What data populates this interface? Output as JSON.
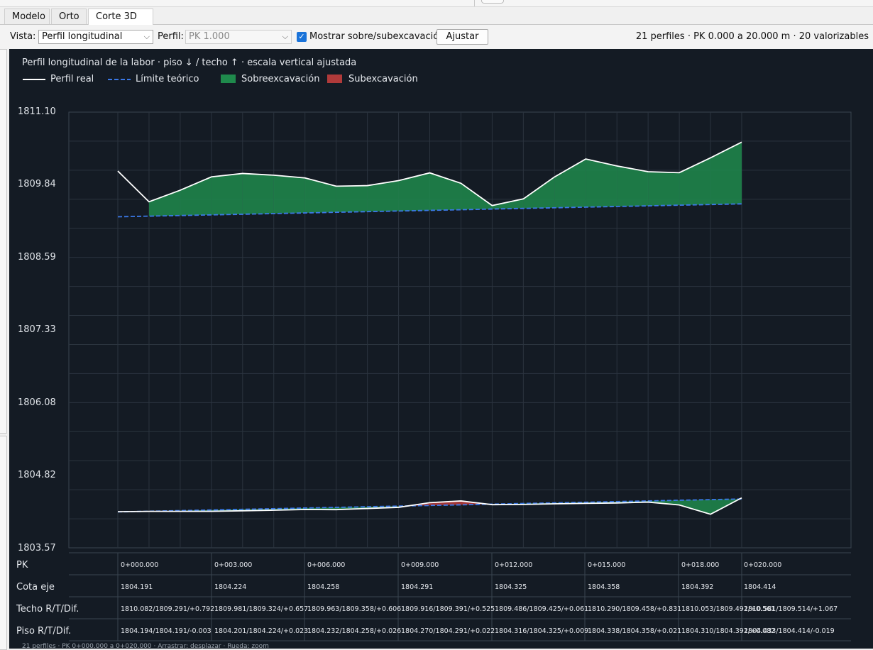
{
  "tabs": [
    {
      "label": "Modelo",
      "active": false
    },
    {
      "label": "Orto",
      "active": false
    },
    {
      "label": "Corte 3D",
      "active": true,
      "closable": true
    }
  ],
  "toolbar": {
    "vista_label": "Vista:",
    "vista_value": "Perfil longitudinal",
    "perfil_label": "Perfil:",
    "perfil_value": "PK 1.000",
    "perfil_enabled": false,
    "mostrar_label": "Mostrar sobre/subexcavación",
    "mostrar_checked": true,
    "ajustar_label": "Ajustar",
    "status": "21 perfiles · PK 0.000 a 20.000 m · 20 valorizables"
  },
  "panel": {
    "title": "Perfil longitudinal de la labor · piso ↓ / techo ↑ · escala vertical ajustada",
    "legend": [
      {
        "label": "Perfil real",
        "kind": "line",
        "color": "#ffffff"
      },
      {
        "label": "Límite teórico",
        "kind": "dashed",
        "color": "#3b78e7"
      },
      {
        "label": "Sobreexcavación",
        "kind": "fill",
        "color": "#1f8a4c"
      },
      {
        "label": "Subexcavación",
        "kind": "fill",
        "color": "#b03a3a"
      }
    ],
    "footer": "21 perfiles · PK 0+000.000 a 0+020.000 · Arrastrar: desplazar · Rueda: zoom"
  },
  "chart_data": {
    "type": "line",
    "xlabel": "PK",
    "x": [
      0,
      1,
      2,
      3,
      4,
      5,
      6,
      7,
      8,
      9,
      10,
      11,
      12,
      13,
      14,
      15,
      16,
      17,
      18,
      19,
      20
    ],
    "ylim": [
      1803.57,
      1811.1
    ],
    "yticks": [
      "1811.10",
      "1809.84",
      "1808.59",
      "1807.33",
      "1806.08",
      "1804.82",
      "1803.57"
    ],
    "grid": true,
    "series": [
      {
        "name": "Techo real",
        "values": [
          1810.082,
          1809.55,
          1809.75,
          1809.981,
          1810.04,
          1810.01,
          1809.963,
          1809.82,
          1809.83,
          1809.916,
          1810.05,
          1809.87,
          1809.486,
          1809.6,
          1809.98,
          1810.29,
          1810.17,
          1810.07,
          1810.053,
          1810.31,
          1810.581
        ]
      },
      {
        "name": "Techo teórico",
        "values": [
          1809.291,
          1809.302,
          1809.313,
          1809.324,
          1809.335,
          1809.346,
          1809.358,
          1809.369,
          1809.38,
          1809.391,
          1809.402,
          1809.413,
          1809.425,
          1809.436,
          1809.447,
          1809.458,
          1809.469,
          1809.48,
          1809.492,
          1809.503,
          1809.514
        ]
      },
      {
        "name": "Piso real",
        "values": [
          1804.194,
          1804.2,
          1804.2,
          1804.201,
          1804.21,
          1804.22,
          1804.232,
          1804.23,
          1804.25,
          1804.27,
          1804.35,
          1804.38,
          1804.316,
          1804.32,
          1804.33,
          1804.338,
          1804.345,
          1804.36,
          1804.31,
          1804.15,
          1804.433
        ]
      },
      {
        "name": "Piso teórico",
        "values": [
          1804.191,
          1804.202,
          1804.213,
          1804.224,
          1804.235,
          1804.246,
          1804.258,
          1804.269,
          1804.28,
          1804.291,
          1804.302,
          1804.313,
          1804.325,
          1804.336,
          1804.347,
          1804.358,
          1804.369,
          1804.38,
          1804.392,
          1804.403,
          1804.414
        ]
      }
    ]
  },
  "table": {
    "row_labels": [
      "PK",
      "Cota eje",
      "Techo R/T/Dif.",
      "Piso R/T/Dif."
    ],
    "columns": [
      {
        "pk": "0+000.000",
        "cota": "1804.191",
        "techo": "1810.082/1809.291/+0.792",
        "piso": "1804.194/1804.191/-0.003"
      },
      {
        "pk": "0+003.000",
        "cota": "1804.224",
        "techo": "1809.981/1809.324/+0.657",
        "piso": "1804.201/1804.224/+0.023"
      },
      {
        "pk": "0+006.000",
        "cota": "1804.258",
        "techo": "1809.963/1809.358/+0.606",
        "piso": "1804.232/1804.258/+0.026"
      },
      {
        "pk": "0+009.000",
        "cota": "1804.291",
        "techo": "1809.916/1809.391/+0.525",
        "piso": "1804.270/1804.291/+0.022"
      },
      {
        "pk": "0+012.000",
        "cota": "1804.325",
        "techo": "1809.486/1809.425/+0.061",
        "piso": "1804.316/1804.325/+0.009"
      },
      {
        "pk": "0+015.000",
        "cota": "1804.358",
        "techo": "1810.290/1809.458/+0.831",
        "piso": "1804.338/1804.358/+0.021"
      },
      {
        "pk": "0+018.000",
        "cota": "1804.392",
        "techo": "1810.053/1809.492/+0.561",
        "piso": "1804.310/1804.392/+0.082"
      },
      {
        "pk": "0+020.000",
        "cota": "1804.414",
        "techo": "1810.581/1809.514/+1.067",
        "piso": "1804.433/1804.414/-0.019"
      }
    ]
  }
}
